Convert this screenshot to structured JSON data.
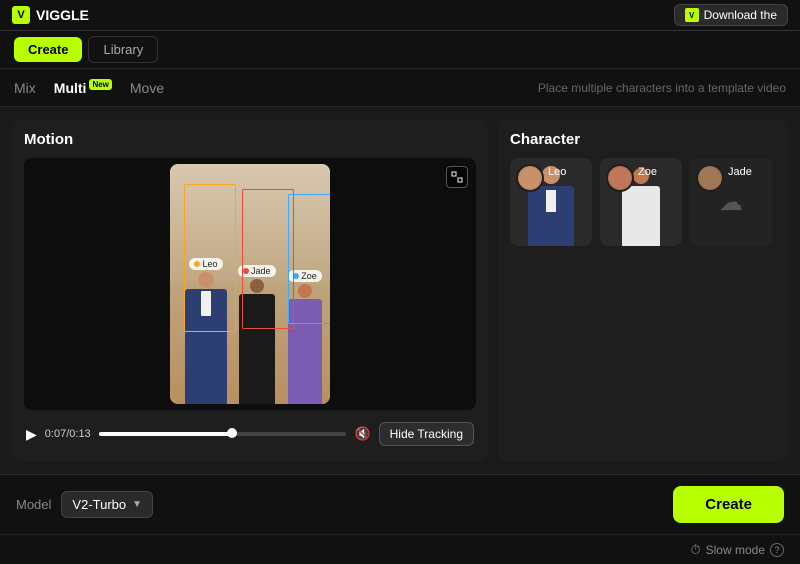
{
  "topbar": {
    "logo_text": "VIGGLE",
    "logo_icon": "V",
    "download_label": "Download the"
  },
  "nav": {
    "create_label": "Create",
    "library_label": "Library"
  },
  "mode_tabs": {
    "mix_label": "Mix",
    "multi_label": "Multi",
    "multi_badge": "New",
    "move_label": "Move",
    "hint": "Place multiple characters into a template video"
  },
  "motion_panel": {
    "title": "Motion",
    "time_current": "0:07",
    "time_total": "0:13",
    "hide_tracking_label": "Hide Tracking",
    "characters": [
      {
        "name": "Leo",
        "color": "#f5a623"
      },
      {
        "name": "Jade",
        "color": "#e74c3c"
      },
      {
        "name": "Zoe",
        "color": "#3baaff"
      }
    ]
  },
  "character_panel": {
    "title": "Character",
    "characters": [
      {
        "name": "Leo",
        "has_model": true
      },
      {
        "name": "Zoe",
        "has_model": true
      },
      {
        "name": "Jade",
        "has_model": false
      }
    ]
  },
  "bottom_bar": {
    "model_label": "Model",
    "model_value": "V2-Turbo",
    "create_label": "Create",
    "slow_mode_label": "Slow mode"
  }
}
